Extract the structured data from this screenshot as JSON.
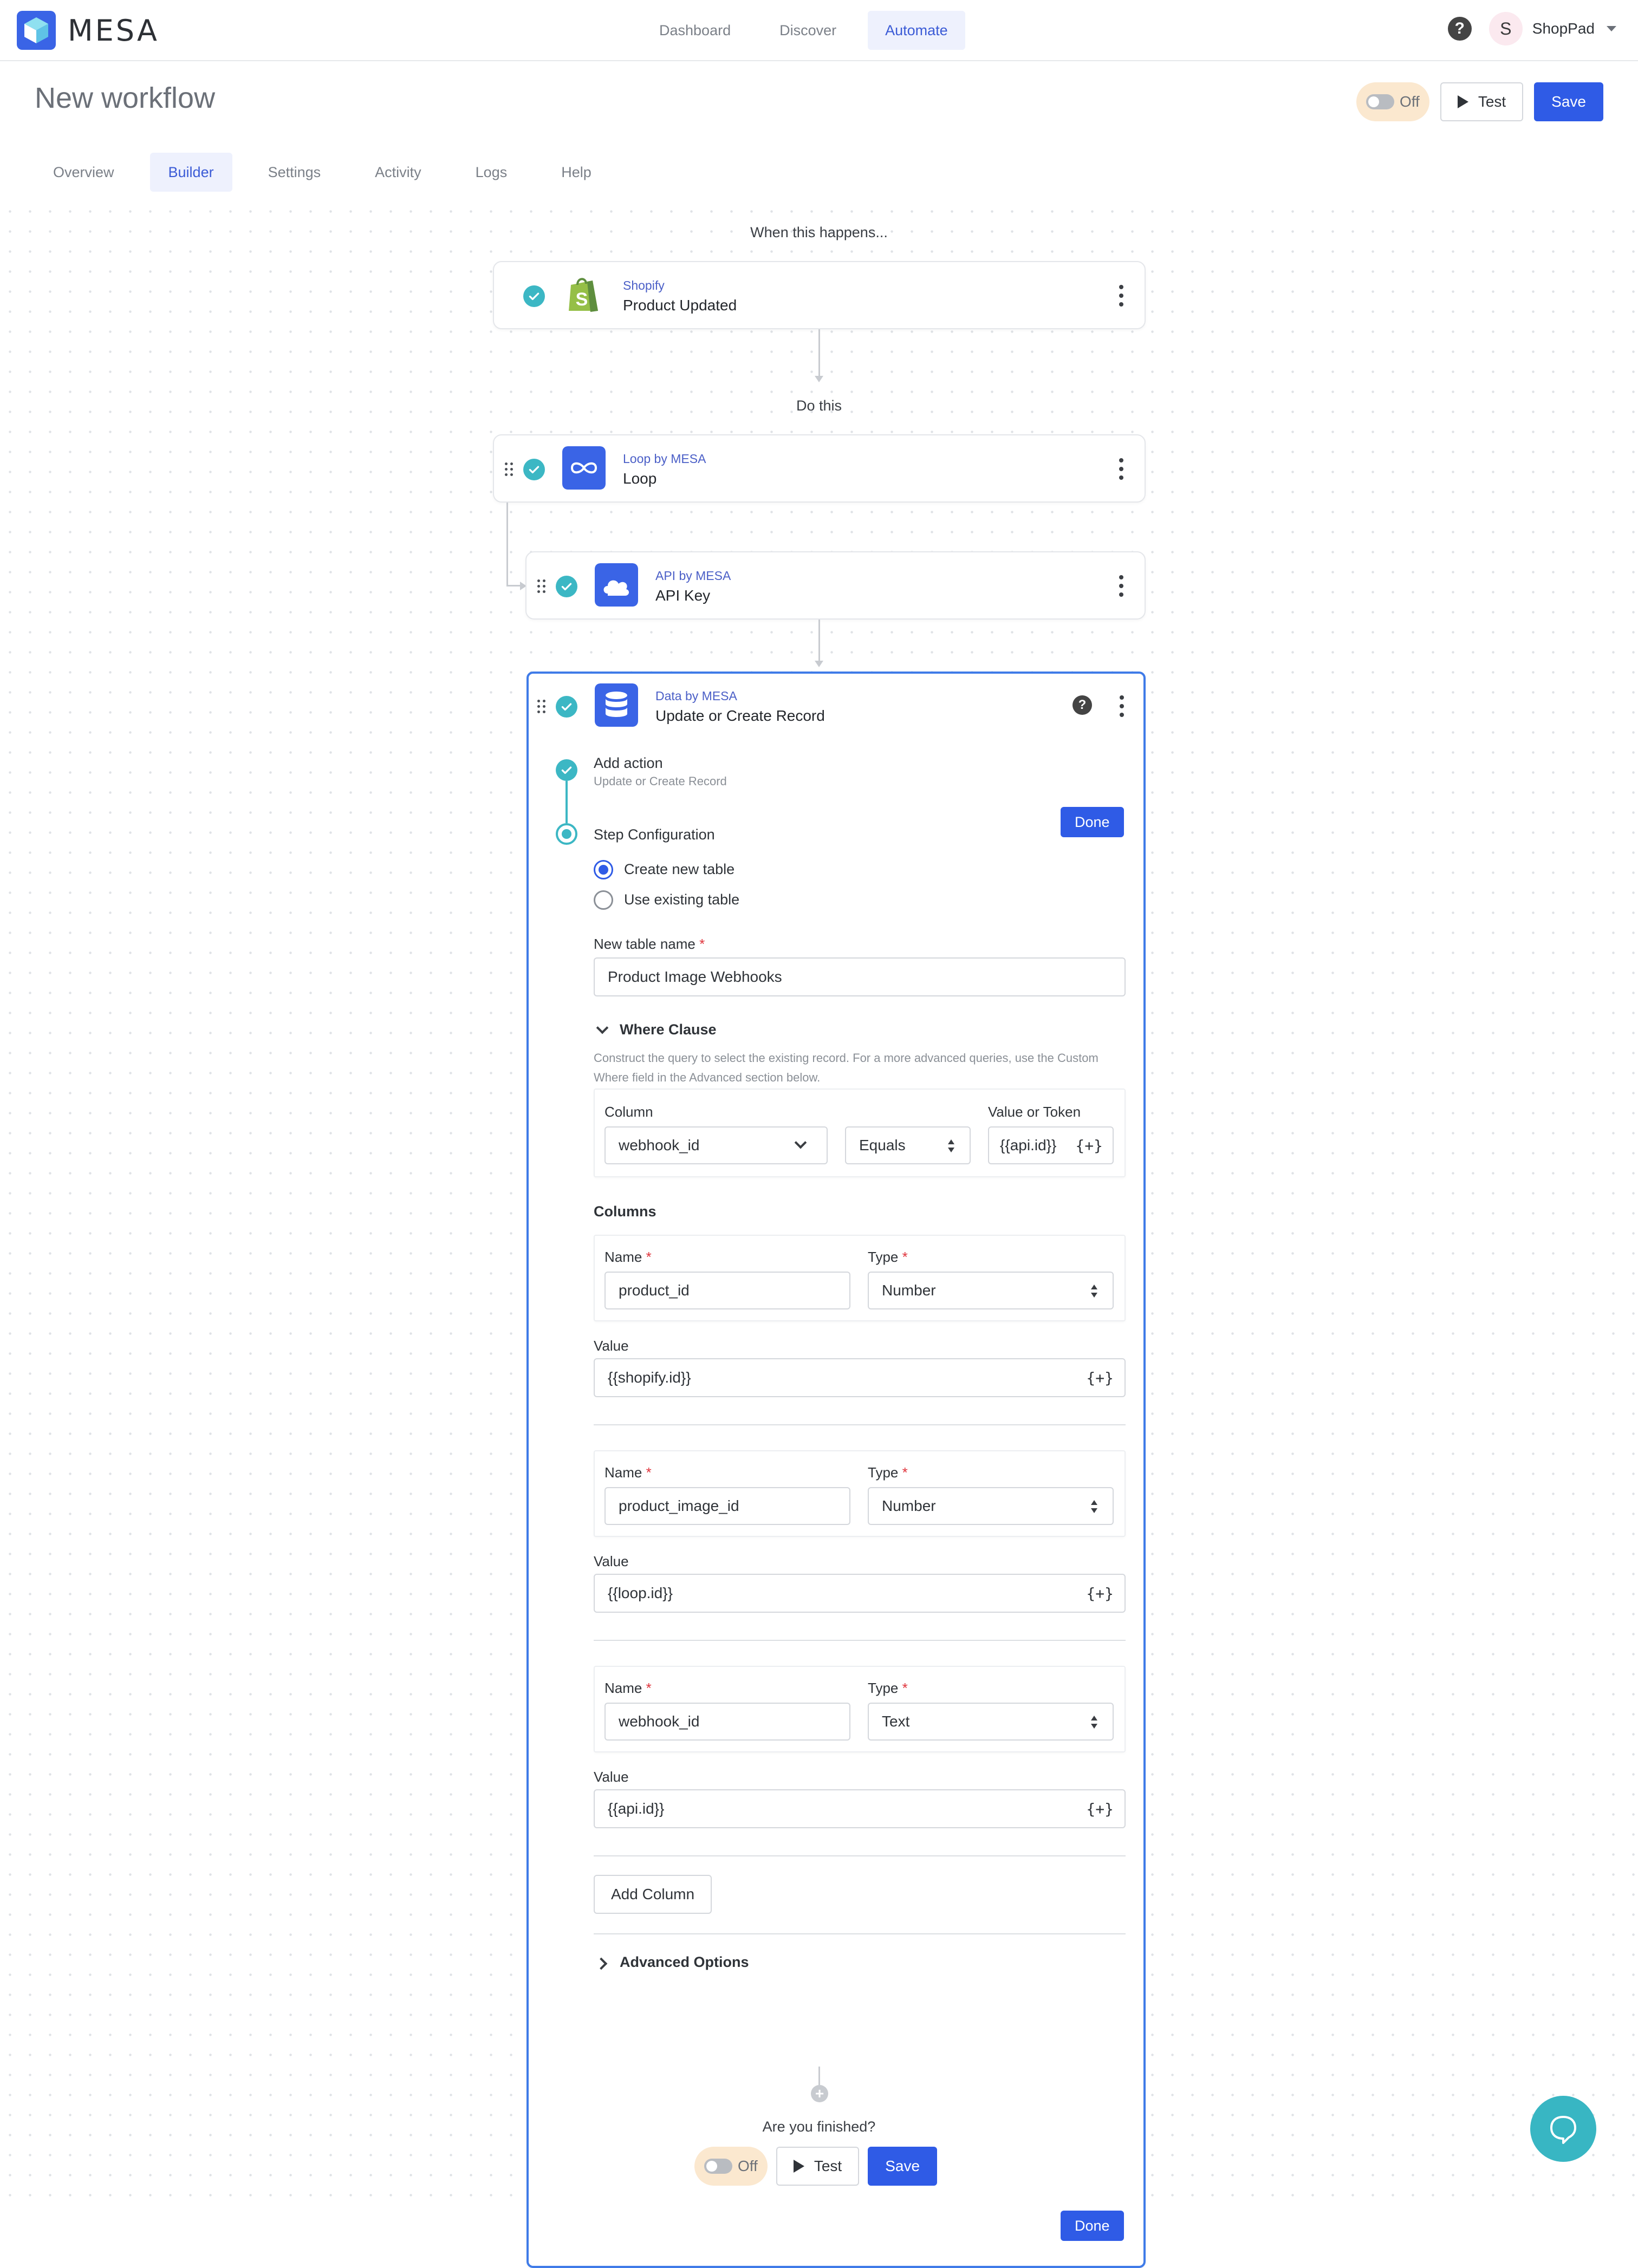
{
  "app": {
    "brand": "MESA"
  },
  "topnav": {
    "items": [
      "Dashboard",
      "Discover",
      "Automate"
    ],
    "active": "Automate"
  },
  "user": {
    "initial": "S",
    "store": "ShopPad"
  },
  "page": {
    "title": "New workflow",
    "toggle_label": "Off",
    "test_label": "Test",
    "save_label": "Save"
  },
  "tabs": {
    "items": [
      "Overview",
      "Builder",
      "Settings",
      "Activity",
      "Logs",
      "Help"
    ],
    "active": "Builder"
  },
  "workflow": {
    "trigger_heading": "When this happens...",
    "action_heading": "Do this",
    "trigger": {
      "app": "Shopify",
      "event": "Product Updated"
    },
    "loop": {
      "app": "Loop by MESA",
      "event": "Loop"
    },
    "api": {
      "app": "API by MESA",
      "event": "API Key"
    },
    "data": {
      "app": "Data by MESA",
      "event": "Update or Create Record"
    }
  },
  "step_form": {
    "add_action_title": "Add action",
    "add_action_sub": "Update or Create Record",
    "step_config_title": "Step Configuration",
    "done_label": "Done",
    "radio_create": "Create new table",
    "radio_existing": "Use existing table",
    "table_name_label": "New table name",
    "table_name_value": "Product Image Webhooks",
    "where_title": "Where Clause",
    "where_help": "Construct the query to select the existing record. For a more advanced queries, use the Custom Where field in the Advanced section below.",
    "where": {
      "column_label": "Column",
      "column_value": "webhook_id",
      "operator_value": "Equals",
      "value_label": "Value or Token",
      "value_value": "{{api.id}}"
    },
    "columns_title": "Columns",
    "name_label": "Name",
    "type_label": "Type",
    "value_label": "Value",
    "token_glyph": "{+}",
    "columns": [
      {
        "name": "product_id",
        "type": "Number",
        "value": "{{shopify.id}}"
      },
      {
        "name": "product_image_id",
        "type": "Number",
        "value": "{{loop.id}}"
      },
      {
        "name": "webhook_id",
        "type": "Text",
        "value": "{{api.id}}"
      }
    ],
    "add_column_label": "Add Column",
    "advanced_label": "Advanced Options"
  },
  "footer": {
    "question": "Are you finished?",
    "toggle_label": "Off",
    "test_label": "Test",
    "save_label": "Save"
  },
  "colors": {
    "primary": "#2f5be6",
    "teal_check": "#3cb7c4",
    "selected_border": "#3f7be8",
    "shopify_green": "#95bf47",
    "mesa_blue": "#3a64e6"
  }
}
